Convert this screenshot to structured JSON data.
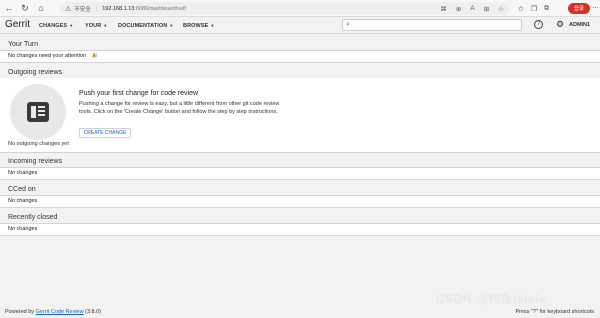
{
  "browser": {
    "security_label": "不安全",
    "url_host": "192.168.1.13",
    "url_path": ":8080/dashboard/self",
    "login_label": "登录"
  },
  "header": {
    "logo": "Gerrit",
    "nav": [
      {
        "label": "CHANGES"
      },
      {
        "label": "YOUR"
      },
      {
        "label": "DOCUMENTATION"
      },
      {
        "label": "BROWSE"
      }
    ],
    "search_placeholder": "",
    "user": "ADMIN1"
  },
  "sections": {
    "your_turn": {
      "title": "Your Turn",
      "body": "No changes need your attention"
    },
    "outgoing": {
      "title": "Outgoing reviews",
      "empty_label": "No outgoing changes yet",
      "push_title": "Push your first change for code review",
      "push_desc": "Pushing a change for review is easy, but a little different from other git code review tools. Click on the 'Create Change' button and follow the step by step instructions.",
      "create_button": "CREATE CHANGE"
    },
    "incoming": {
      "title": "Incoming reviews",
      "body": "No changes"
    },
    "cced": {
      "title": "CCed on",
      "body": "No changes"
    },
    "closed": {
      "title": "Recently closed",
      "body": "No changes"
    }
  },
  "footer": {
    "powered_by": "Powered by",
    "link": "Gerrit Code Review",
    "version": "(3.8.0)",
    "shortcuts": "Press \"?\" for keyboard shortcuts"
  },
  "watermark": "CSDN @钓鱼lalala"
}
